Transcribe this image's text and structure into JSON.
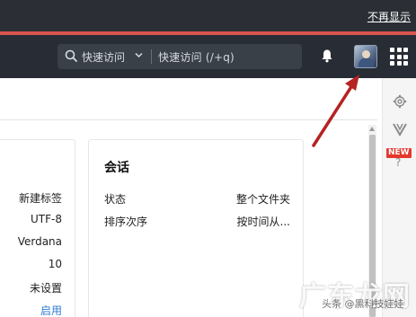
{
  "topbar": {
    "dismiss_label": "不再显示"
  },
  "navbar": {
    "quick_access_label": "快速访问",
    "quick_access_hint": "快速访问 (/+q)"
  },
  "left_card": {
    "values": [
      "新建标签",
      "UTF-8",
      "Verdana",
      "10",
      "未设置",
      "启用"
    ]
  },
  "session_card": {
    "title": "会话",
    "rows": [
      {
        "label": "状态",
        "value": "整个文件夹"
      },
      {
        "label": "排序次序",
        "value": "按时间从..."
      }
    ]
  },
  "rightbar": {
    "new_badge": "NEW",
    "help_glyph": "?"
  },
  "watermark": {
    "logo_text": "广东龙网",
    "caption": "头条 @黑科技娃娃"
  },
  "colors": {
    "accent_red": "#d9534f",
    "navbar_bg": "#282d35",
    "link_blue": "#2e7bd6",
    "arrow_red": "#b52222"
  }
}
